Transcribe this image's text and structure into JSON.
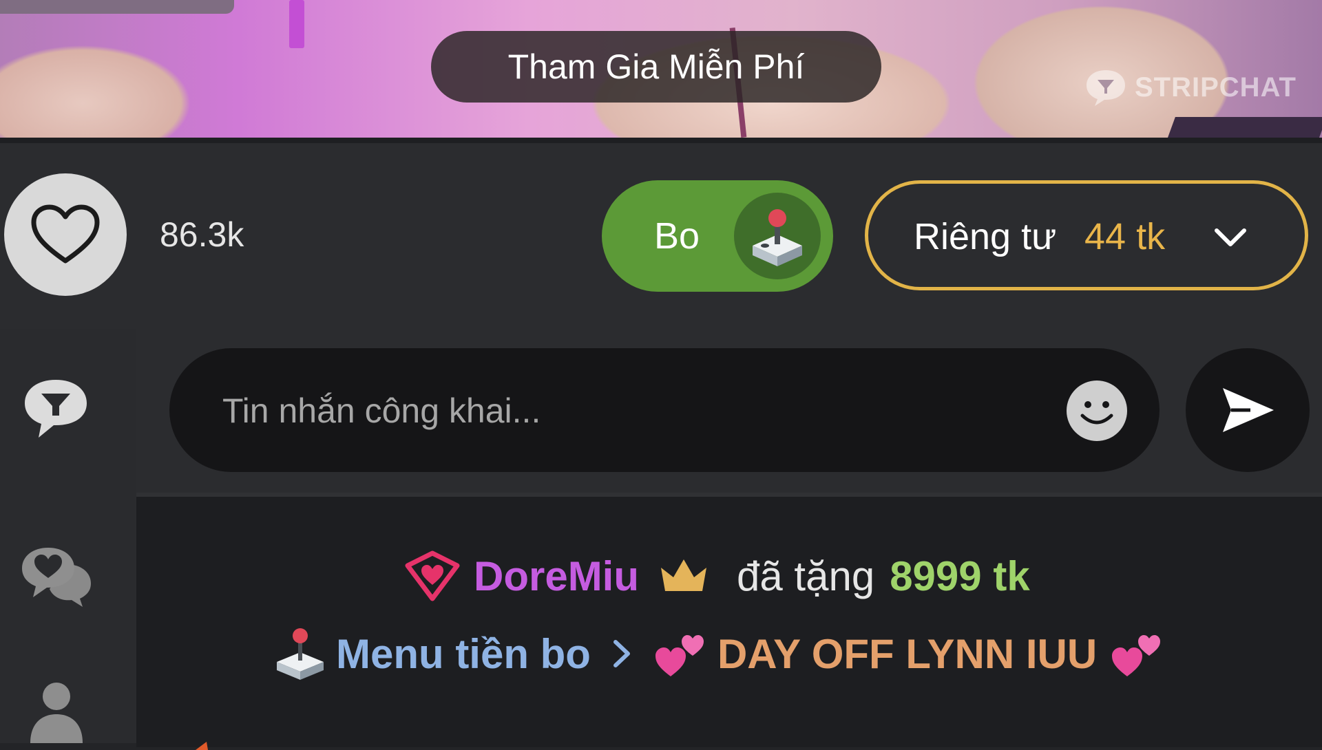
{
  "video": {
    "join_button": "Tham Gia Miễn Phí",
    "watermark": "STRIPCHAT"
  },
  "actions": {
    "like_count": "86.3k",
    "tip_label": "Bo",
    "private_label": "Riêng tư",
    "private_price": "44 tk"
  },
  "input": {
    "placeholder": "Tin nhắn công khai..."
  },
  "chat": {
    "gift_user": "DoreMiu",
    "gift_text": "đã tặng",
    "gift_amount": "8999 tk",
    "menu_link": "Menu tiền bo",
    "menu_title": "DAY OFF LYNN IUU"
  },
  "colors": {
    "accent_gold": "#e2b448",
    "tip_green": "#5c9a37",
    "username_purple": "#c55ce0",
    "amount_green": "#9fd36a",
    "menu_blue": "#8fb3e4",
    "menu_orange": "#e4a06b"
  },
  "icons": {
    "like": "heart-outline-icon",
    "tip": "joystick-icon",
    "private_dropdown": "chevron-down-icon",
    "public_chat": "chat-bubble-icon",
    "private_chat": "chat-bubbles-icon",
    "users": "user-icon",
    "emoji": "smiley-icon",
    "send": "send-icon",
    "gift_badge": "gem-icon",
    "king": "crown-icon",
    "decoration": "two-hearts-icon"
  }
}
